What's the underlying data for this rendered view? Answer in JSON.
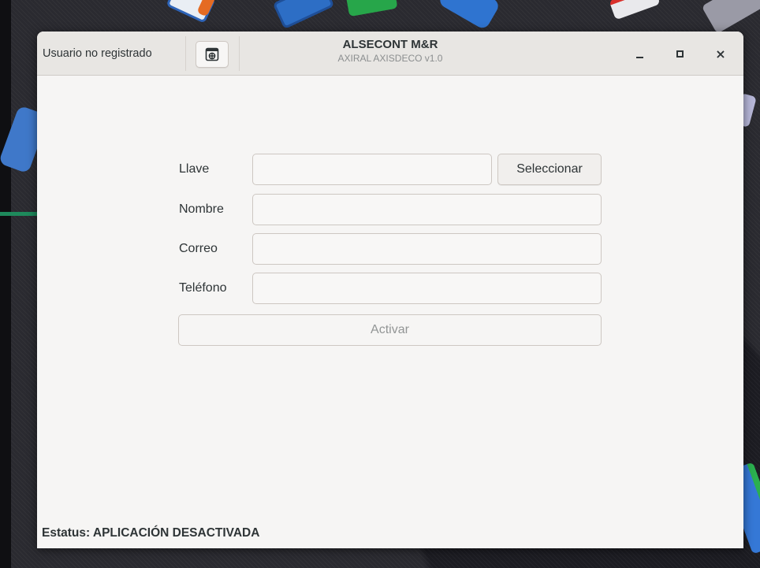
{
  "window": {
    "title": "ALSECONT M&R",
    "subtitle": "AXIRAL AXISDECO v1.0",
    "user_label": "Usuario no registrado",
    "header_icon": "app-menu-icon",
    "controls": {
      "minimize": "minimize-icon",
      "maximize": "maximize-icon",
      "close_glyph": "×"
    }
  },
  "form": {
    "fields": [
      {
        "label": "Llave",
        "value": "",
        "placeholder": ""
      },
      {
        "label": "Nombre",
        "value": "",
        "placeholder": ""
      },
      {
        "label": "Correo",
        "value": "",
        "placeholder": ""
      },
      {
        "label": "Teléfono",
        "value": "",
        "placeholder": ""
      }
    ],
    "select_button": "Seleccionar",
    "activate_button": "Activar"
  },
  "status": {
    "text": "Estatus: APLICACIÓN DESACTIVADA"
  },
  "colors": {
    "arrow": "#1e8a5c",
    "window_bg": "#f6f5f4",
    "headerbar_bg": "#e8e6e3"
  }
}
